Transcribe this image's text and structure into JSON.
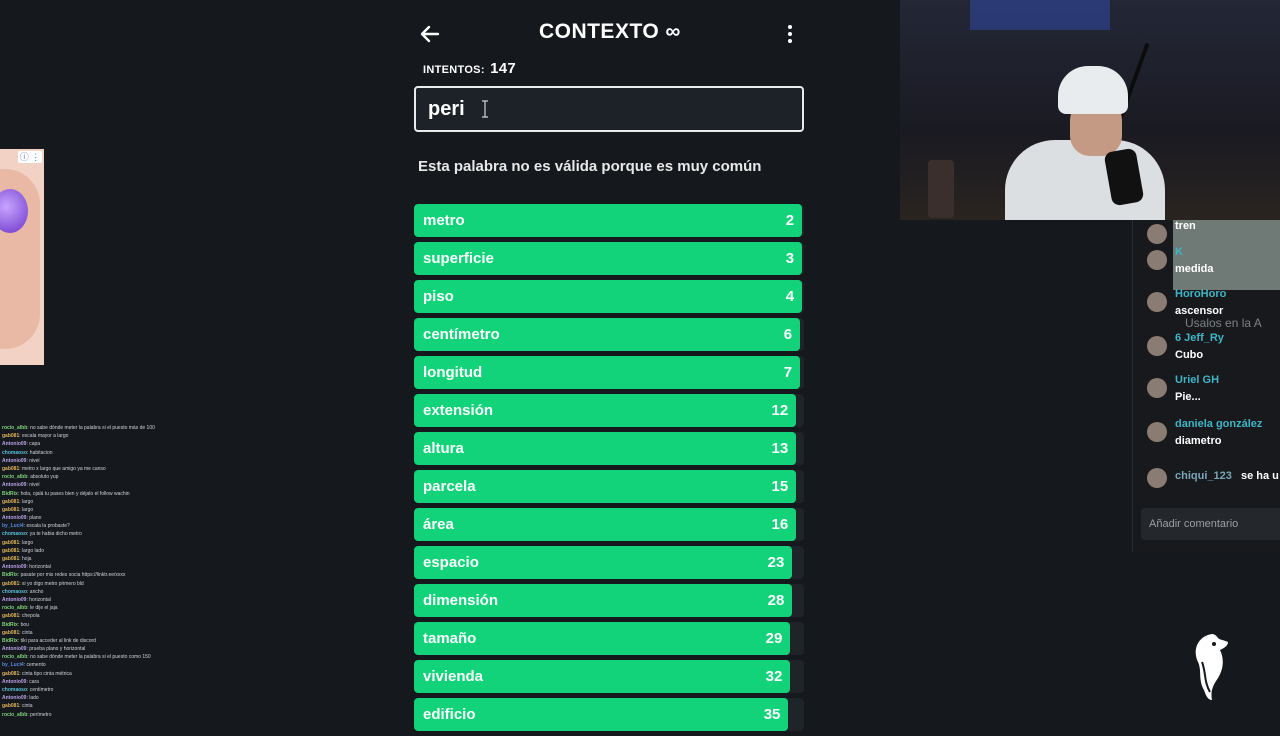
{
  "game": {
    "title": "CONTEXTO ∞",
    "attempts_label": "INTENTOS:",
    "attempts_value": "147",
    "input_value": "peri",
    "message": "Esta palabra no es válida porque es muy común",
    "results": [
      {
        "word": "metro",
        "rank": "2",
        "score": 0.995
      },
      {
        "word": "superficie",
        "rank": "3",
        "score": 0.995
      },
      {
        "word": "piso",
        "rank": "4",
        "score": 0.995
      },
      {
        "word": "centímetro",
        "rank": "6",
        "score": 0.99
      },
      {
        "word": "longitud",
        "rank": "7",
        "score": 0.99
      },
      {
        "word": "extensión",
        "rank": "12",
        "score": 0.98
      },
      {
        "word": "altura",
        "rank": "13",
        "score": 0.98
      },
      {
        "word": "parcela",
        "rank": "15",
        "score": 0.98
      },
      {
        "word": "área",
        "rank": "16",
        "score": 0.98
      },
      {
        "word": "espacio",
        "rank": "23",
        "score": 0.97
      },
      {
        "word": "dimensión",
        "rank": "28",
        "score": 0.97
      },
      {
        "word": "tamaño",
        "rank": "29",
        "score": 0.965
      },
      {
        "word": "vivienda",
        "rank": "32",
        "score": 0.965
      },
      {
        "word": "edificio",
        "rank": "35",
        "score": 0.96
      }
    ],
    "colors": {
      "bar": "#12d37a",
      "background": "#15191d"
    }
  },
  "left_chat": [
    {
      "user": "rocio_albb",
      "text": ": no sabe dónde meter la palabra si el puesto más de 100",
      "color": "#7ed37a"
    },
    {
      "user": "gab081",
      "text": ": escala mayor a largo",
      "color": "#e0b35a"
    },
    {
      "user": "Antonio09",
      "text": ": capa",
      "color": "#b9a0e6"
    },
    {
      "user": "chomaoso",
      "text": ": habitacion",
      "color": "#5ac0d8"
    },
    {
      "user": "Antonio09",
      "text": ": nivel",
      "color": "#b9a0e6"
    },
    {
      "user": "gab081",
      "text": ": metro x largo que amigo ya me canso",
      "color": "#e0b35a"
    },
    {
      "user": "rocio_albb",
      "text": ": absoluto yup",
      "color": "#7ed37a"
    },
    {
      "user": "Antonio09",
      "text": ": nivel",
      "color": "#b9a0e6"
    },
    {
      "user": "BidRix",
      "text": ": hola, ojalá tu pases bien y déjalo el follow wachin",
      "color": "#7ed37a"
    },
    {
      "user": "gab081",
      "text": ": largo",
      "color": "#e0b35a"
    },
    {
      "user": "gab081",
      "text": ": largo",
      "color": "#e0b35a"
    },
    {
      "user": "Antonio09",
      "text": ": plano",
      "color": "#b9a0e6"
    },
    {
      "user": "by_Luci4",
      "text": ": escala la probaste?",
      "color": "#5a8ae0"
    },
    {
      "user": "chomaoso",
      "text": ": ya te habia dicho metro",
      "color": "#5ac0d8"
    },
    {
      "user": "gab081",
      "text": ": largo",
      "color": "#e0b35a"
    },
    {
      "user": "gab081",
      "text": ": largo lado",
      "color": "#e0b35a"
    },
    {
      "user": "gab081",
      "text": ": hoja",
      "color": "#e0b35a"
    },
    {
      "user": "Antonio09",
      "text": ": horizontal",
      "color": "#b9a0e6"
    },
    {
      "user": "BidRix",
      "text": ": pasate por mis redes socia https://linktr.ee/xxxx",
      "color": "#7ed37a"
    },
    {
      "user": "gab081",
      "text": ": si yo digo metro primero bld",
      "color": "#e0b35a"
    },
    {
      "user": "chomaoso",
      "text": ": ancho",
      "color": "#5ac0d8"
    },
    {
      "user": "Antonio09",
      "text": ": horizontal",
      "color": "#b9a0e6"
    },
    {
      "user": "rocio_albb",
      "text": ": le dije el jaja",
      "color": "#7ed37a"
    },
    {
      "user": "gab081",
      "text": ": chepola",
      "color": "#e0b35a"
    },
    {
      "user": "BidRix",
      "text": ": bou",
      "color": "#7ed37a"
    },
    {
      "user": "gab081",
      "text": ": cinta",
      "color": "#e0b35a"
    },
    {
      "user": "BidRix",
      "text": ": tiki para acceder al link de discord",
      "color": "#7ed37a"
    },
    {
      "user": "Antonio09",
      "text": ": prueba plano y horizontal",
      "color": "#b9a0e6"
    },
    {
      "user": "rocio_albb",
      "text": ": no sabe dónde meter la palabra si el puesto como 150",
      "color": "#7ed37a"
    },
    {
      "user": "by_Luci4",
      "text": ": cemento",
      "color": "#5a8ae0"
    },
    {
      "user": "gab081",
      "text": ": cinta tipo cinta métrica",
      "color": "#e0b35a"
    },
    {
      "user": "Antonio09",
      "text": ": cara",
      "color": "#b9a0e6"
    },
    {
      "user": "chomaoso",
      "text": ": centímetro",
      "color": "#5ac0d8"
    },
    {
      "user": "Antonio09",
      "text": ": lado",
      "color": "#b9a0e6"
    },
    {
      "user": "gab081",
      "text": ": cinta",
      "color": "#e0b35a"
    },
    {
      "user": "rocio_albb",
      "text": ": perímetro",
      "color": "#7ed37a"
    }
  ],
  "right_chat": {
    "overlay_text": "Usalos en la A",
    "items": [
      {
        "name": "",
        "msg": "tren"
      },
      {
        "name": "K",
        "msg": "medida"
      },
      {
        "name": "HoroHoro",
        "msg": "ascensor"
      },
      {
        "name": "6  Jeff_Ry",
        "msg": "Cubo"
      },
      {
        "name": "Uriel GH",
        "msg": "Pie..."
      },
      {
        "name": "daniela gonzález",
        "msg": "diametro"
      },
      {
        "name": "chiqui_123",
        "msg": "se ha u"
      }
    ],
    "comment_placeholder": "Añadir comentario"
  }
}
